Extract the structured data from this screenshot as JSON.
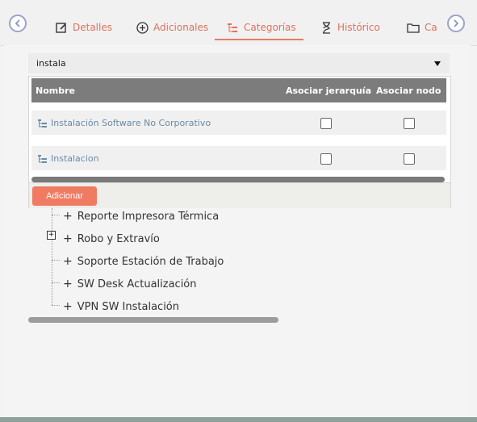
{
  "tabs": [
    {
      "label": "Detalles",
      "icon": "edit-icon"
    },
    {
      "label": "Adicionales",
      "icon": "plus-circle-icon"
    },
    {
      "label": "Categorías",
      "icon": "tree-icon",
      "active": true
    },
    {
      "label": "Histórico",
      "icon": "hourglass-icon"
    },
    {
      "label": "Ca",
      "icon": "folder-icon"
    }
  ],
  "search": {
    "value": "instala"
  },
  "popup": {
    "columns": [
      "Nombre",
      "Asociar jerarquía",
      "Asociar nodo"
    ],
    "rows": [
      {
        "name": "Instalación Software No Corporativo",
        "asociar_jerarquia": false,
        "asociar_nodo": false
      },
      {
        "name": "Instalacion",
        "asociar_jerarquia": false,
        "asociar_nodo": false
      }
    ],
    "add_button": "Adicionar"
  },
  "tree": {
    "items": [
      {
        "label": "Reporte Impresora Térmica"
      },
      {
        "label": "Robo y Extravío"
      },
      {
        "label": "Soporte Estación de Trabajo"
      },
      {
        "label": "SW Desk Actualización"
      },
      {
        "label": "VPN SW Instalación"
      }
    ]
  },
  "colors": {
    "accent": "#e87b65",
    "header": "#7c7c7c",
    "button": "#f07b62"
  }
}
